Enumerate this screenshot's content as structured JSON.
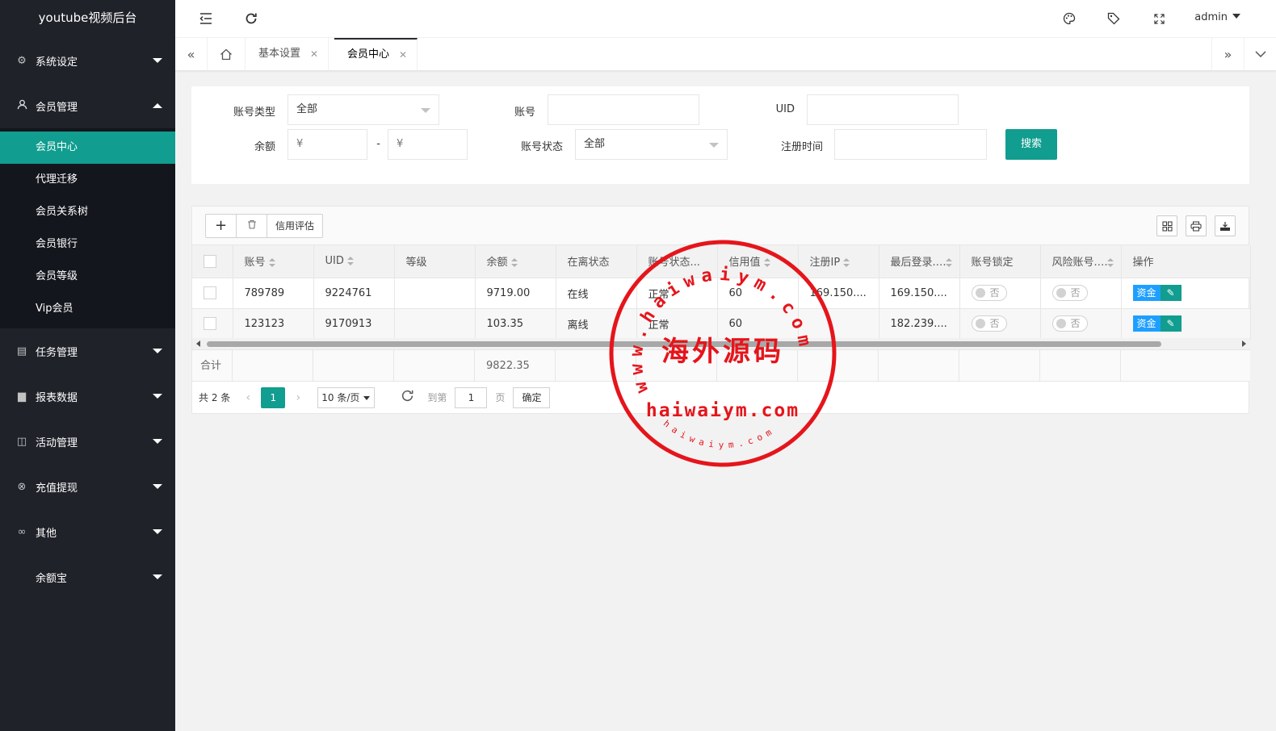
{
  "app": {
    "title": "youtube视频后台"
  },
  "sidebar": {
    "menus": [
      {
        "label": "系统设定",
        "icon": "gear-icon",
        "expanded": false
      },
      {
        "label": "会员管理",
        "icon": "user-icon",
        "expanded": true,
        "children": [
          "会员中心",
          "代理迁移",
          "会员关系树",
          "会员银行",
          "会员等级",
          "Vip会员"
        ],
        "active_child": "会员中心"
      },
      {
        "label": "任务管理",
        "icon": "doc-icon",
        "expanded": false
      },
      {
        "label": "报表数据",
        "icon": "monitor-icon",
        "expanded": false
      },
      {
        "label": "活动管理",
        "icon": "book-icon",
        "expanded": false
      },
      {
        "label": "充值提现",
        "icon": "yen-icon",
        "expanded": false
      },
      {
        "label": "其他",
        "icon": "link-icon",
        "expanded": false
      },
      {
        "label": "余额宝",
        "icon": "",
        "expanded": false
      }
    ]
  },
  "header": {
    "user": "admin"
  },
  "tabs": [
    {
      "label": "基本设置",
      "active": false
    },
    {
      "label": "会员中心",
      "active": true
    }
  ],
  "search": {
    "account_type_label": "账号类型",
    "account_type_value": "全部",
    "account_label": "账号",
    "account_value": "",
    "uid_label": "UID",
    "uid_value": "",
    "balance_label": "余额",
    "balance_min_placeholder": "¥",
    "balance_dash": "-",
    "balance_max_placeholder": "¥",
    "status_label": "账号状态",
    "status_value": "全部",
    "reg_time_label": "注册时间",
    "reg_time_value": "",
    "search_button": "搜索"
  },
  "toolbar": {
    "add_glyph": "+",
    "credit_label": "信用评估"
  },
  "table": {
    "columns": [
      "账号",
      "UID",
      "等级",
      "余额",
      "在离状态",
      "账号状态...",
      "信用值",
      "注册IP",
      "最后登录...",
      "账号锁定",
      "风险账号...",
      "操作"
    ],
    "rows": [
      {
        "account": "789789",
        "uid": "9224761",
        "level": "",
        "balance": "9719.00",
        "online": "在线",
        "status": "正常",
        "credit": "60",
        "reg_ip": "169.150....",
        "last_login": "169.150....",
        "lock": "否",
        "risk": "否"
      },
      {
        "account": "123123",
        "uid": "9170913",
        "level": "",
        "balance": "103.35",
        "online": "离线",
        "status": "正常",
        "credit": "60",
        "reg_ip": "",
        "last_login": "182.239....",
        "lock": "否",
        "risk": "否"
      }
    ],
    "fund_button": "资金",
    "total_label": "合计",
    "total_balance": "9822.35"
  },
  "pager": {
    "total": "共 2 条",
    "current_page": "1",
    "page_size": "10 条/页",
    "goto_label": "到第",
    "goto_value": "1",
    "page_unit": "页",
    "confirm": "确定"
  },
  "watermark": {
    "cn_text": "海外源码",
    "domain": "haiwaiym.com",
    "ring_top": "www.haiwaiym.com",
    "ring_bottom": "haiwaiym.com",
    "color": "#e5151b"
  },
  "colors": {
    "sidebar_bg": "#20222a",
    "accent": "#119d8f",
    "fund_blue": "#1e9fff"
  }
}
